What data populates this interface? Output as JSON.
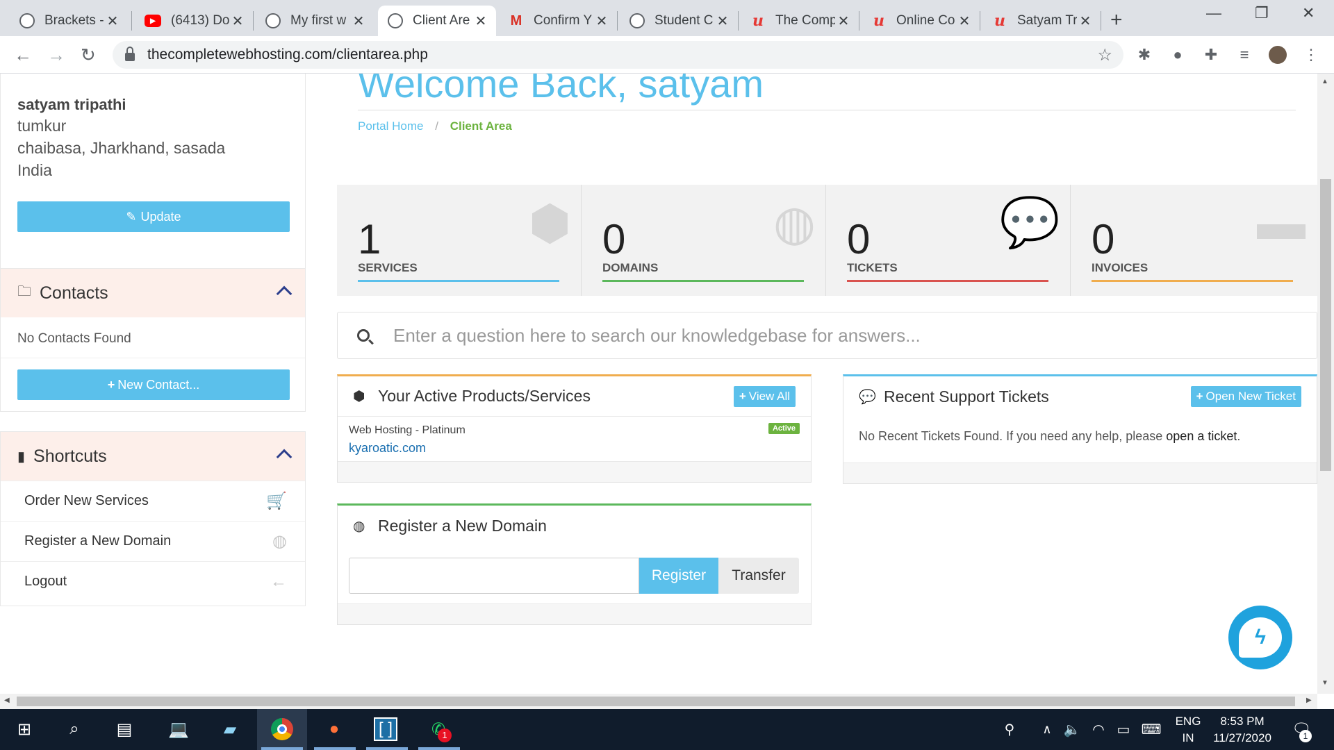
{
  "browser": {
    "tabs": [
      {
        "title": "Brackets - ",
        "icon": "globe-icon"
      },
      {
        "title": "(6413) Do",
        "icon": "youtube-icon"
      },
      {
        "title": "My first w",
        "icon": "globe-icon"
      },
      {
        "title": "Client Are",
        "icon": "globe-icon",
        "active": true
      },
      {
        "title": "Confirm Y",
        "icon": "gmail-icon"
      },
      {
        "title": "Student C",
        "icon": "globe-icon"
      },
      {
        "title": "The Comp",
        "icon": "udemy-icon"
      },
      {
        "title": "Online Co",
        "icon": "udemy-icon"
      },
      {
        "title": "Satyam Tr",
        "icon": "udemy-icon"
      }
    ],
    "url": "thecompletewebhosting.com/clientarea.php"
  },
  "sidebar": {
    "address": {
      "name": "satyam tripathi",
      "line1": "tumkur",
      "line2": "chaibasa, Jharkhand, sasada",
      "line3": "India",
      "update_label": "Update"
    },
    "contacts": {
      "title": "Contacts",
      "empty_text": "No Contacts Found",
      "new_label": "New Contact..."
    },
    "shortcuts": {
      "title": "Shortcuts",
      "items": [
        {
          "label": "Order New Services",
          "icon": "cart-icon"
        },
        {
          "label": "Register a New Domain",
          "icon": "globe-icon"
        },
        {
          "label": "Logout",
          "icon": "arrow-left-icon"
        }
      ]
    }
  },
  "main": {
    "welcome": "Welcome Back, satyam",
    "breadcrumb": {
      "home": "Portal Home",
      "sep": "/",
      "current": "Client Area"
    },
    "tiles": [
      {
        "count": "1",
        "label": "SERVICES",
        "color": "#5bc0eb",
        "icon": "cube-icon"
      },
      {
        "count": "0",
        "label": "DOMAINS",
        "color": "#5cb85c",
        "icon": "globe-icon"
      },
      {
        "count": "0",
        "label": "TICKETS",
        "color": "#d9534f",
        "icon": "comments-icon"
      },
      {
        "count": "0",
        "label": "INVOICES",
        "color": "#f0ad4e",
        "icon": "credit-card-icon"
      }
    ],
    "kb_placeholder": "Enter a question here to search our knowledgebase for answers...",
    "products": {
      "title": "Your Active Products/Services",
      "view_all": "View All",
      "item_name": "Web Hosting - Platinum",
      "item_domain": "kyaroatic.com",
      "item_status": "Active"
    },
    "tickets": {
      "title": "Recent Support Tickets",
      "open_new": "Open New Ticket",
      "empty_text": "No Recent Tickets Found. If you need any help, please",
      "link_text": "open a ticket",
      "end": "."
    },
    "domain": {
      "title": "Register a New Domain",
      "register": "Register",
      "transfer": "Transfer"
    }
  },
  "taskbar": {
    "lang1": "ENG",
    "lang2": "IN",
    "time": "8:53 PM",
    "date": "11/27/2020",
    "whatsapp_badge": "1",
    "notif_count": "1"
  },
  "colors": {
    "accent": "#5bc0eb",
    "green": "#6cb33f"
  }
}
